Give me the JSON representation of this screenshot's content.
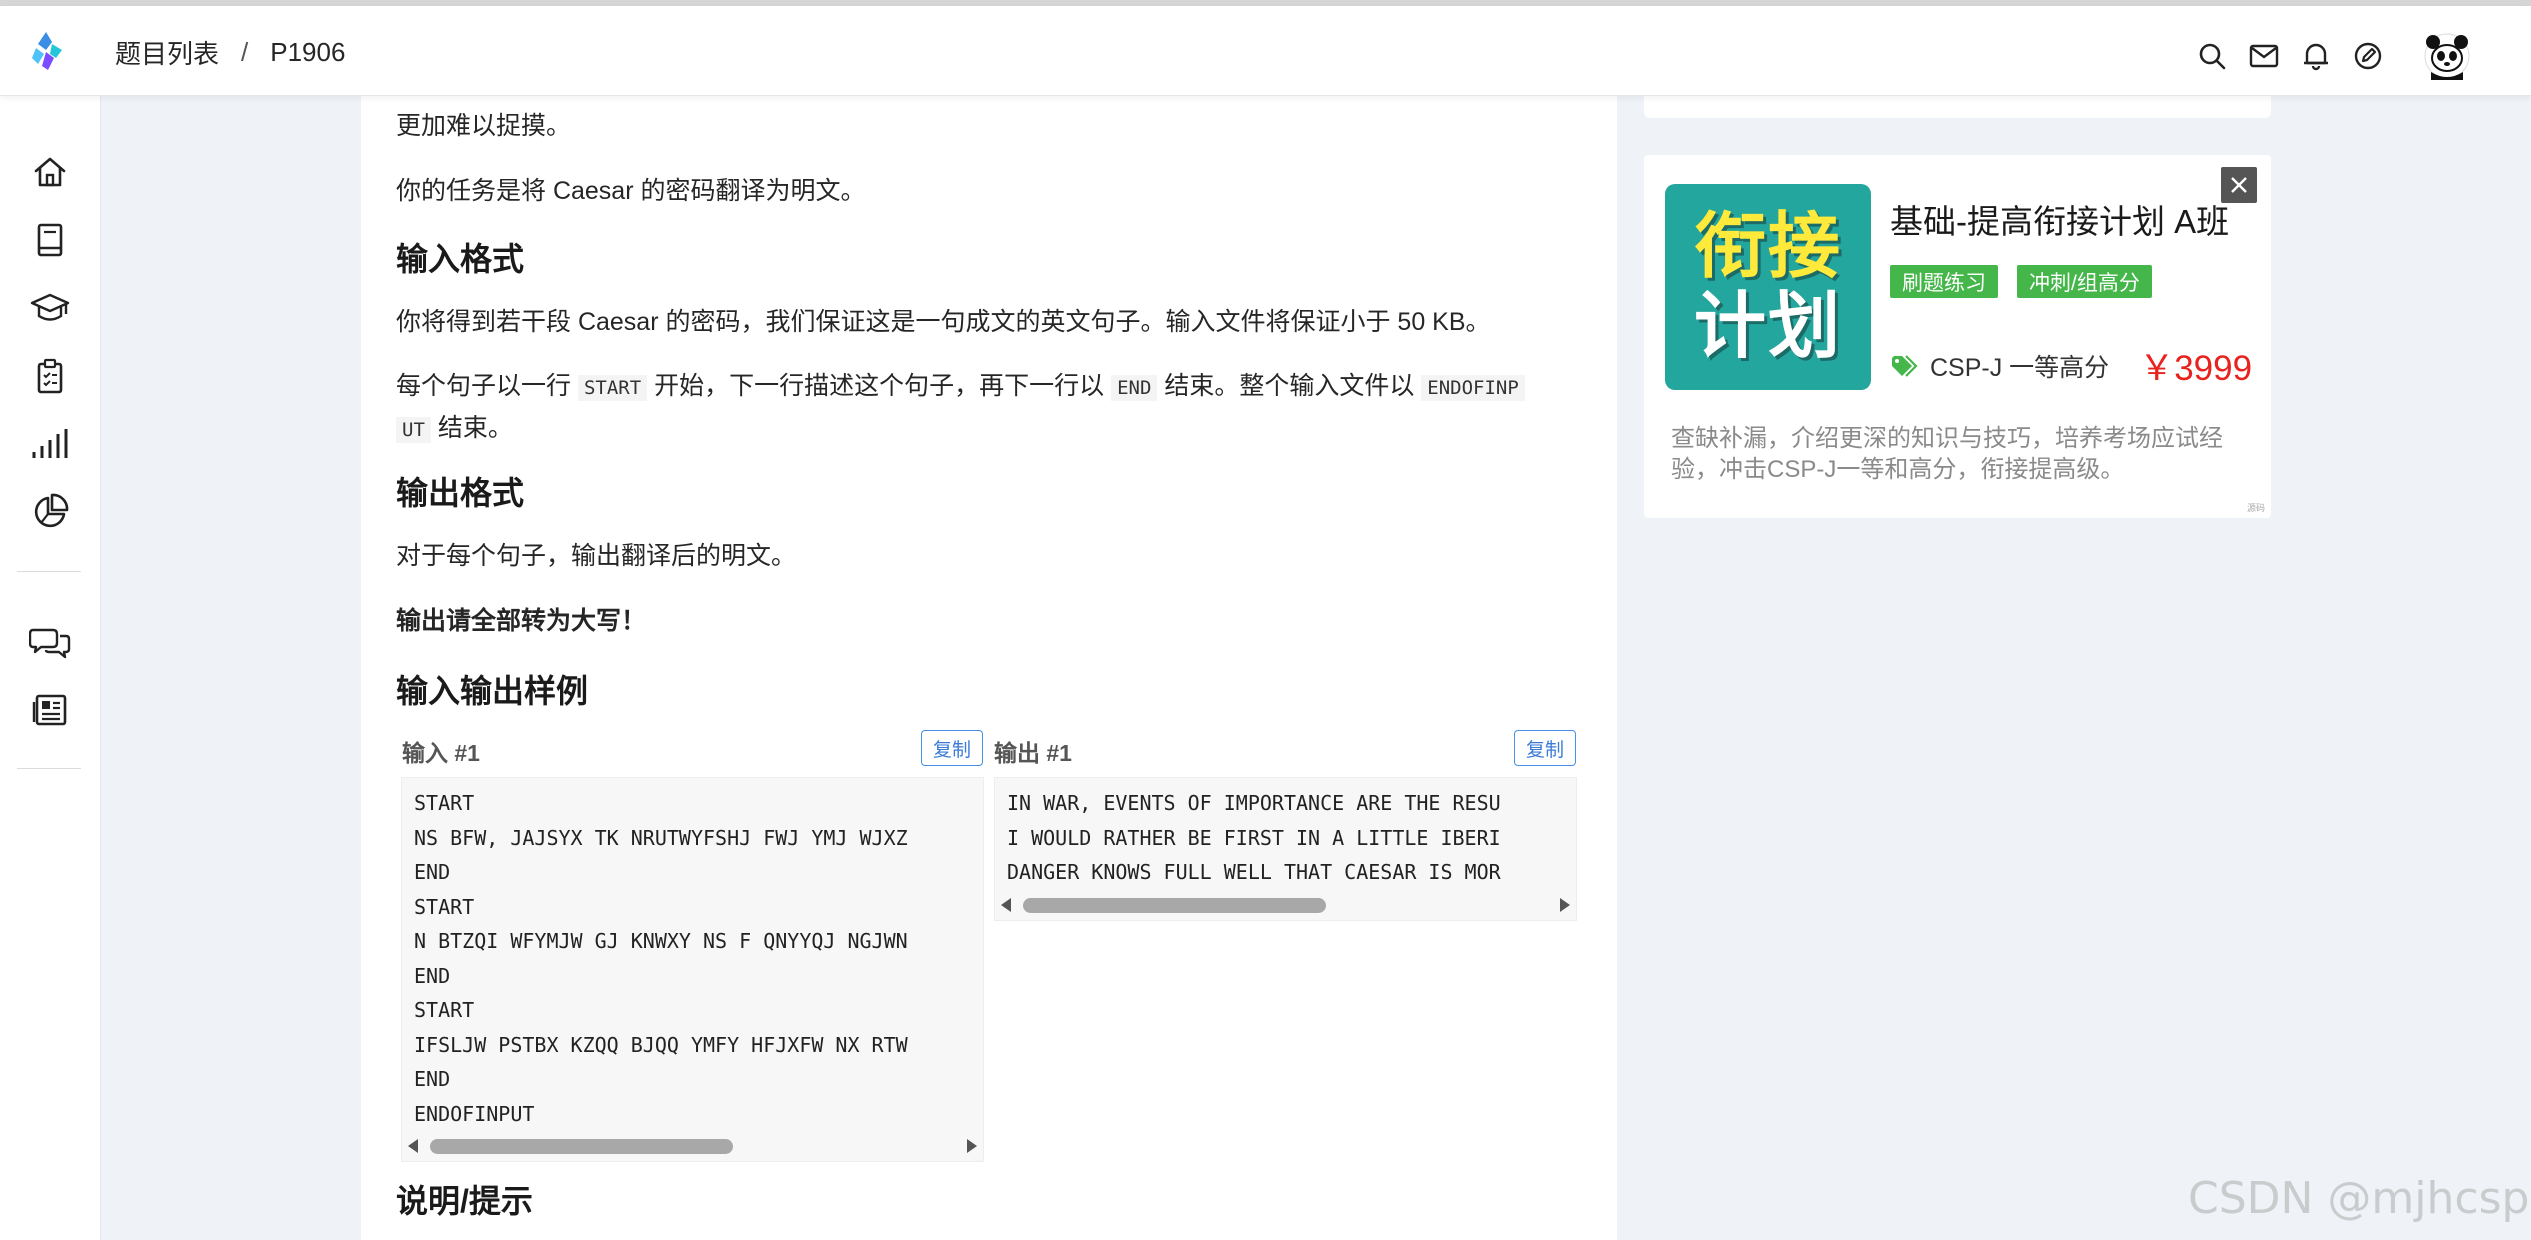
{
  "header": {
    "breadcrumb": [
      "题目列表",
      "P1906"
    ],
    "separator": "/"
  },
  "sidebar": {
    "items": [
      "home-icon",
      "book-icon",
      "graduation-cap-icon",
      "clipboard-icon",
      "signal-bars-icon",
      "pie-chart-icon",
      "discussion-icon",
      "newspaper-icon"
    ]
  },
  "content": {
    "p_top": "更加难以捉摸。",
    "p_task": "你的任务是将 Caesar 的密码翻译为明文。",
    "h_input": "输入格式",
    "p_input1": "你将得到若干段 Caesar 的密码，我们保证这是一句成文的英文句子。输入文件将保证小于 50 KB。",
    "p_input2_a": "每个句子以一行 ",
    "code_start": "START",
    "p_input2_b": " 开始，下一行描述这个句子，再下一行以 ",
    "code_end": "END",
    "p_input2_c": " 结束。整个输入文件以 ",
    "code_eoi_1": "ENDOFINP",
    "code_eoi_2": "UT",
    "p_input2_d": " 结束。",
    "h_output": "输出格式",
    "p_output": "对于每个句子，输出翻译后的明文。",
    "p_upper": "输出请全部转为大写！",
    "h_samples": "输入输出样例",
    "input_label": "输入 #1",
    "output_label": "输出 #1",
    "copy_label": "复制",
    "input_lines": "START\nNS BFW, JAJSYX TK NRUTWYFSHJ FWJ YMJ WJXZ\nEND\nSTART\nN BTZQI WFYMJW GJ KNWXY NS F QNYYQJ NGJWN\nEND\nSTART\nIFSLJW PSTBX KZQQ BJQQ YMFY HFJXFW NX RTW\nEND\nENDOFINPUT",
    "output_lines": "IN WAR, EVENTS OF IMPORTANCE ARE THE RESU\nI WOULD RATHER BE FIRST IN A LITTLE IBERI\nDANGER KNOWS FULL WELL THAT CAESAR IS MOR",
    "h_hint": "说明/提示"
  },
  "ad": {
    "image_line1": "衔接",
    "image_line2": "计划",
    "title": "基础-提高衔接计划  A班",
    "tags": [
      "刷题练习",
      "冲刺/组高分"
    ],
    "subtitle": "CSP-J 一等高分",
    "price": "￥3999",
    "desc": "查缺补漏，介绍更深的知识与技巧，培养考场应试经验，冲击CSP-J一等和高分，衔接提高级。",
    "mini": "源码",
    "close_icon": "close-icon"
  },
  "watermark": "CSDN @mjhcsp",
  "colors": {
    "accent": "#4a90e2",
    "tag": "#45b649",
    "price": "#e8231f",
    "ad_bg": "#23a69e"
  }
}
